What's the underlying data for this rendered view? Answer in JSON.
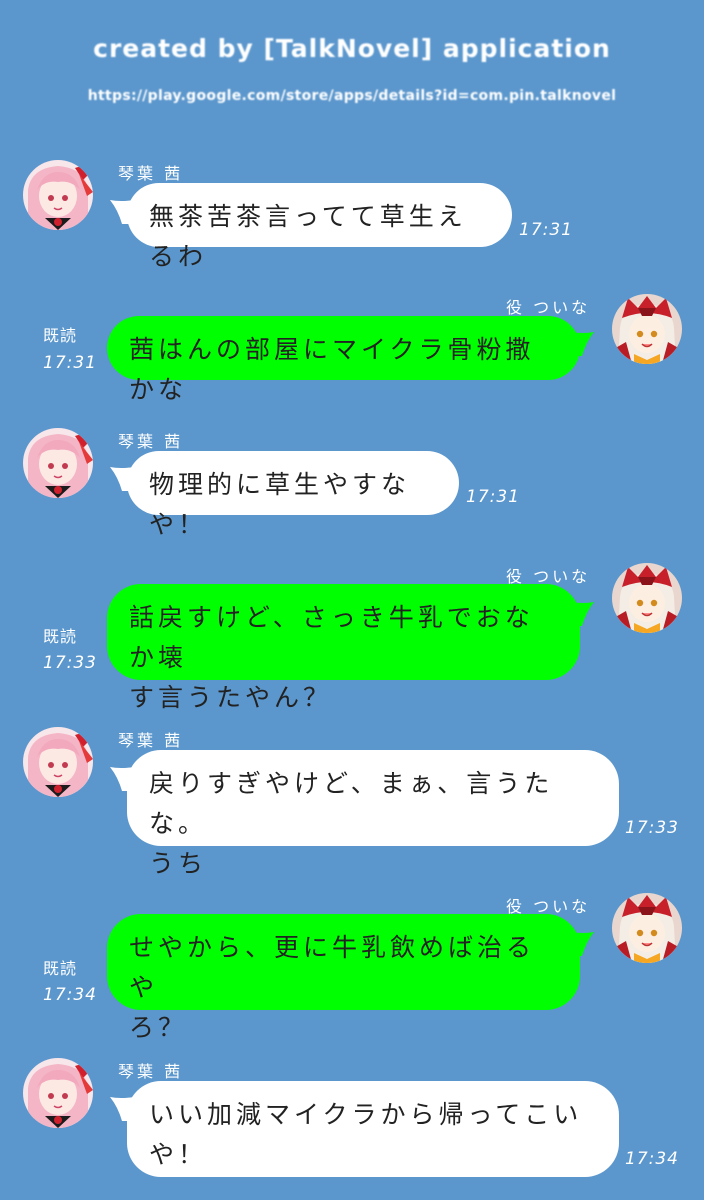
{
  "header": {
    "created_by": "created by [TalkNovel] application",
    "url": "https://play.google.com/store/apps/details?id=com.pin.talknovel"
  },
  "characters": {
    "akane": {
      "name": "琴葉 茜",
      "avatar_icon": "akane-avatar-icon"
    },
    "tsuina": {
      "name": "役 ついな",
      "avatar_icon": "tsuina-avatar-icon"
    }
  },
  "colors": {
    "background": "#5b97cd",
    "incoming_bubble": "#ffffff",
    "outgoing_bubble": "#00ff00"
  },
  "messages": [
    {
      "sender": "琴葉 茜",
      "text": "無茶苦茶言ってて草生えるわ",
      "time": "17:31",
      "read": ""
    },
    {
      "sender": "役 ついな",
      "text": "茜はんの部屋にマイクラ骨粉撒かな",
      "time": "17:31",
      "read": "既読"
    },
    {
      "sender": "琴葉 茜",
      "text": "物理的に草生やすなや！",
      "time": "17:31",
      "read": ""
    },
    {
      "sender": "役 ついな",
      "text": "話戻すけど、さっき牛乳でおなか壊\nす言うたやん？",
      "time": "17:33",
      "read": "既読"
    },
    {
      "sender": "琴葉 茜",
      "text": "戻りすぎやけど、まぁ、言うたな。\nうち",
      "time": "17:33",
      "read": ""
    },
    {
      "sender": "役 ついな",
      "text": "せやから、更に牛乳飲めば治るや\nろ？",
      "time": "17:34",
      "read": "既読"
    },
    {
      "sender": "琴葉 茜",
      "text": "いい加減マイクラから帰ってこい\nや！",
      "time": "17:34",
      "read": ""
    }
  ]
}
